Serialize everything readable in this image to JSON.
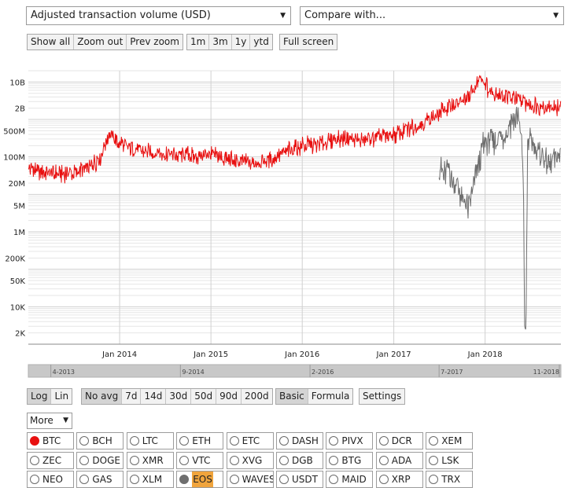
{
  "metric_select": {
    "value": "Adjusted transaction volume (USD)"
  },
  "compare_select": {
    "value": "Compare with..."
  },
  "zoom_buttons": [
    "Show all",
    "Zoom out",
    "Prev zoom"
  ],
  "range_buttons": [
    "1m",
    "3m",
    "1y",
    "ytd"
  ],
  "fullscreen_label": "Full screen",
  "scale_buttons": [
    {
      "label": "Log",
      "active": true
    },
    {
      "label": "Lin",
      "active": false
    }
  ],
  "avg_buttons": [
    {
      "label": "No avg",
      "active": true
    },
    {
      "label": "7d",
      "active": false
    },
    {
      "label": "14d",
      "active": false
    },
    {
      "label": "30d",
      "active": false
    },
    {
      "label": "50d",
      "active": false
    },
    {
      "label": "90d",
      "active": false
    },
    {
      "label": "200d",
      "active": false
    }
  ],
  "mode_buttons": [
    {
      "label": "Basic",
      "active": true
    },
    {
      "label": "Formula",
      "active": false
    }
  ],
  "settings_label": "Settings",
  "more_select": "More",
  "coins": [
    {
      "label": "BTC",
      "state": "red"
    },
    {
      "label": "BCH"
    },
    {
      "label": "LTC"
    },
    {
      "label": "ETH"
    },
    {
      "label": "ETC"
    },
    {
      "label": "DASH"
    },
    {
      "label": "PIVX"
    },
    {
      "label": "DCR"
    },
    {
      "label": "XEM"
    },
    {
      "label": "ZEC"
    },
    {
      "label": "DOGE"
    },
    {
      "label": "XMR"
    },
    {
      "label": "VTC"
    },
    {
      "label": "XVG"
    },
    {
      "label": "DGB"
    },
    {
      "label": "BTG"
    },
    {
      "label": "ADA"
    },
    {
      "label": "LSK"
    },
    {
      "label": "NEO"
    },
    {
      "label": "GAS"
    },
    {
      "label": "XLM"
    },
    {
      "label": "EOS",
      "state": "gray",
      "highlight": true
    },
    {
      "label": "WAVES"
    },
    {
      "label": "USDT"
    },
    {
      "label": "MAID"
    },
    {
      "label": "XRP"
    },
    {
      "label": "TRX"
    }
  ],
  "colors": {
    "btc": "#e81010",
    "eos": "#6e6e6e",
    "navigator": "#c8c8c8",
    "grid": "#d9d9d9"
  },
  "chart_data": {
    "type": "line",
    "y_scale": "log",
    "ylim": [
      1000,
      20000000000
    ],
    "xlim": [
      "2013-01-01",
      "2018-10-31"
    ],
    "ytick_values": [
      2000,
      10000,
      50000,
      200000,
      1000000,
      5000000,
      20000000,
      100000000,
      500000000,
      2000000000,
      10000000000
    ],
    "ytick_labels": [
      "2K",
      "10K",
      "50K",
      "200K",
      "1M",
      "5M",
      "20M",
      "100M",
      "500M",
      "2B",
      "10B"
    ],
    "xtick_values": [
      "2014-01-01",
      "2015-01-01",
      "2016-01-01",
      "2017-01-01",
      "2018-01-01"
    ],
    "xtick_labels": [
      "Jan 2014",
      "Jan 2015",
      "Jan 2016",
      "Jan 2017",
      "Jan 2018"
    ],
    "navigator_labels": [
      {
        "date": "2013-04-01",
        "label": "4-2013"
      },
      {
        "date": "2014-09-01",
        "label": "9-2014"
      },
      {
        "date": "2016-02-01",
        "label": "2-2016"
      },
      {
        "date": "2017-07-01",
        "label": "7-2017"
      },
      {
        "date": "2018-11-01",
        "label": "11-2018"
      }
    ],
    "grid": true,
    "series": [
      {
        "key": "btc",
        "values": [
          [
            "2013-01-01",
            50000000
          ],
          [
            "2013-03-01",
            40000000
          ],
          [
            "2013-05-01",
            35000000
          ],
          [
            "2013-07-01",
            38000000
          ],
          [
            "2013-09-01",
            50000000
          ],
          [
            "2013-10-15",
            100000000
          ],
          [
            "2013-11-20",
            450000000
          ],
          [
            "2013-12-15",
            280000000
          ],
          [
            "2014-01-15",
            200000000
          ],
          [
            "2014-03-01",
            160000000
          ],
          [
            "2014-05-01",
            130000000
          ],
          [
            "2014-07-01",
            120000000
          ],
          [
            "2014-09-01",
            110000000
          ],
          [
            "2014-11-01",
            105000000
          ],
          [
            "2015-01-15",
            115000000
          ],
          [
            "2015-03-01",
            90000000
          ],
          [
            "2015-05-01",
            75000000
          ],
          [
            "2015-07-01",
            70000000
          ],
          [
            "2015-09-01",
            85000000
          ],
          [
            "2015-11-01",
            150000000
          ],
          [
            "2016-01-15",
            200000000
          ],
          [
            "2016-03-01",
            220000000
          ],
          [
            "2016-05-01",
            280000000
          ],
          [
            "2016-07-01",
            300000000
          ],
          [
            "2016-09-01",
            280000000
          ],
          [
            "2016-11-01",
            330000000
          ],
          [
            "2017-01-15",
            400000000
          ],
          [
            "2017-03-01",
            550000000
          ],
          [
            "2017-05-01",
            800000000
          ],
          [
            "2017-07-01",
            1500000000
          ],
          [
            "2017-09-01",
            2500000000
          ],
          [
            "2017-11-01",
            4000000000
          ],
          [
            "2017-12-15",
            15000000000
          ],
          [
            "2018-01-15",
            6000000000
          ],
          [
            "2018-03-01",
            4500000000
          ],
          [
            "2018-05-01",
            3500000000
          ],
          [
            "2018-07-01",
            2500000000
          ],
          [
            "2018-09-01",
            2200000000
          ],
          [
            "2018-10-31",
            2000000000
          ]
        ]
      },
      {
        "key": "eos",
        "values": [
          [
            "2017-07-01",
            60000000
          ],
          [
            "2017-07-20",
            30000000
          ],
          [
            "2017-08-10",
            50000000
          ],
          [
            "2017-08-25",
            20000000
          ],
          [
            "2017-09-15",
            15000000
          ],
          [
            "2017-10-05",
            7000000
          ],
          [
            "2017-10-25",
            4500000
          ],
          [
            "2017-11-15",
            15000000
          ],
          [
            "2017-12-05",
            50000000
          ],
          [
            "2017-12-25",
            200000000
          ],
          [
            "2018-01-15",
            300000000
          ],
          [
            "2018-02-15",
            250000000
          ],
          [
            "2018-03-15",
            350000000
          ],
          [
            "2018-04-15",
            800000000
          ],
          [
            "2018-05-15",
            1200000000
          ],
          [
            "2018-05-28",
            250000000
          ],
          [
            "2018-06-03",
            40000000
          ],
          [
            "2018-06-08",
            1500
          ],
          [
            "2018-06-14",
            6000
          ],
          [
            "2018-06-20",
            300000000
          ],
          [
            "2018-07-15",
            200000000
          ],
          [
            "2018-08-15",
            100000000
          ],
          [
            "2018-09-15",
            70000000
          ],
          [
            "2018-10-31",
            120000000
          ]
        ]
      }
    ]
  }
}
